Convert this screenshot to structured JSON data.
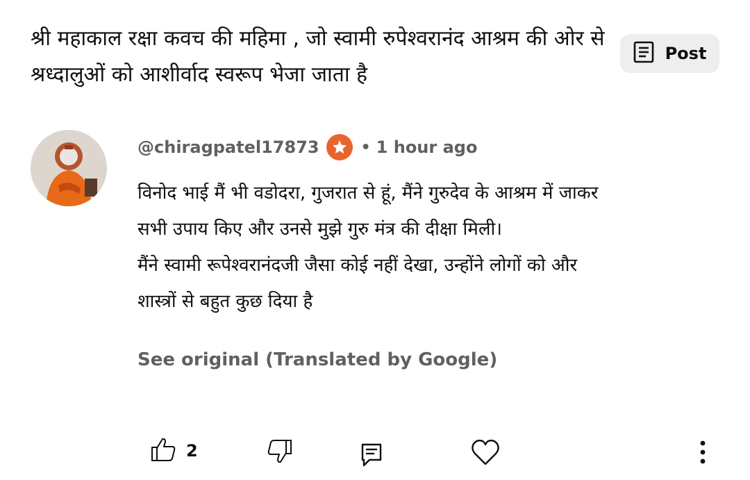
{
  "video": {
    "title": "श्री महाकाल रक्षा कवच की महिमा , जो स्वामी रुपेश्वरानंद आश्रम की ओर से श्रध्दालुओं को आशीर्वाद स्वरूप भेजा जाता है"
  },
  "post_button": {
    "label": "Post",
    "icon": "post-list-icon"
  },
  "comment": {
    "author": "@chiragpatel17873",
    "badge_icon": "star-badge-icon",
    "separator": "•",
    "time": "1 hour ago",
    "lines": [
      "विनोद भाई मैं भी वडोदरा, गुजरात से हूं, मैंने गुरुदेव के आश्रम में जाकर",
      "सभी उपाय किए और उनसे मुझे गुरु मंत्र की दीक्षा मिली।",
      "मैंने स्वामी रूपेश्वरानंदजी जैसा कोई नहीं देखा, उन्होंने लोगों को और",
      "शास्त्रों से बहुत कुछ दिया है"
    ],
    "see_original": "See original (Translated by Google)",
    "likes": "2"
  },
  "colors": {
    "badge": "#e8642c",
    "secondary_text": "#606060",
    "post_bg": "#eeeeee"
  }
}
